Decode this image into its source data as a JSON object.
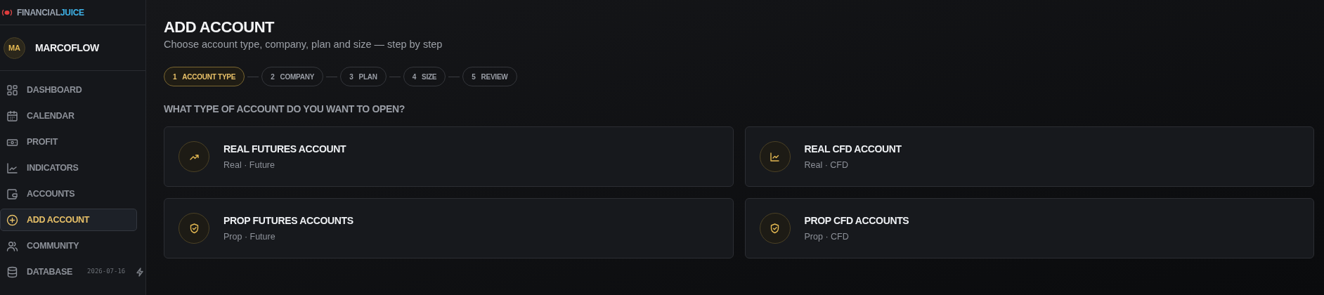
{
  "brand": {
    "part_1": "FINANCIAL",
    "part_2": "JUICE"
  },
  "user": {
    "initials": "MA",
    "name": "MARCOFLOW"
  },
  "sidebar": {
    "items": [
      {
        "label": "DASHBOARD",
        "selected": false
      },
      {
        "label": "CALENDAR",
        "selected": false
      },
      {
        "label": "PROFIT",
        "selected": false
      },
      {
        "label": "INDICATORS",
        "selected": false
      },
      {
        "label": "ACCOUNTS",
        "selected": false
      },
      {
        "label": "ADD ACCOUNT",
        "selected": true
      },
      {
        "label": "COMMUNITY",
        "selected": false
      },
      {
        "label": "DATABASE",
        "selected": false,
        "date": "2026-07-16"
      }
    ]
  },
  "page": {
    "title": "ADD ACCOUNT",
    "subtitle": "Choose account type, company, plan and size — step by step"
  },
  "steps": [
    {
      "number": "1",
      "label": "ACCOUNT TYPE",
      "selected": true
    },
    {
      "number": "2",
      "label": "COMPANY",
      "selected": false
    },
    {
      "number": "3",
      "label": "PLAN",
      "selected": false
    },
    {
      "number": "4",
      "label": "SIZE",
      "selected": false
    },
    {
      "number": "5",
      "label": "REVIEW",
      "selected": false
    }
  ],
  "question": "WHAT TYPE OF ACCOUNT DO YOU WANT TO OPEN?",
  "options": [
    {
      "title": "REAL FUTURES ACCOUNT",
      "subtitle": "Real · Future",
      "kind": "trend"
    },
    {
      "title": "REAL CFD ACCOUNT",
      "subtitle": "Real · CFD",
      "kind": "chart"
    },
    {
      "title": "PROP FUTURES ACCOUNTS",
      "subtitle": "Prop · Future",
      "kind": "shield"
    },
    {
      "title": "PROP CFD ACCOUNTS",
      "subtitle": "Prop · CFD",
      "kind": "shield"
    }
  ]
}
